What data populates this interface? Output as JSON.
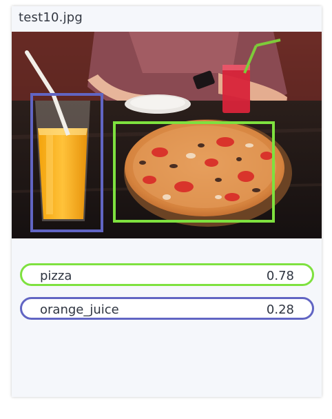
{
  "file": {
    "name": "test10.jpg"
  },
  "photo": {
    "description_icon": "photo-food-table"
  },
  "detections": [
    {
      "label": "pizza",
      "score": "0.78",
      "color": "#7ee13f"
    },
    {
      "label": "orange_juice",
      "score": "0.28",
      "color": "#6165c3"
    }
  ]
}
